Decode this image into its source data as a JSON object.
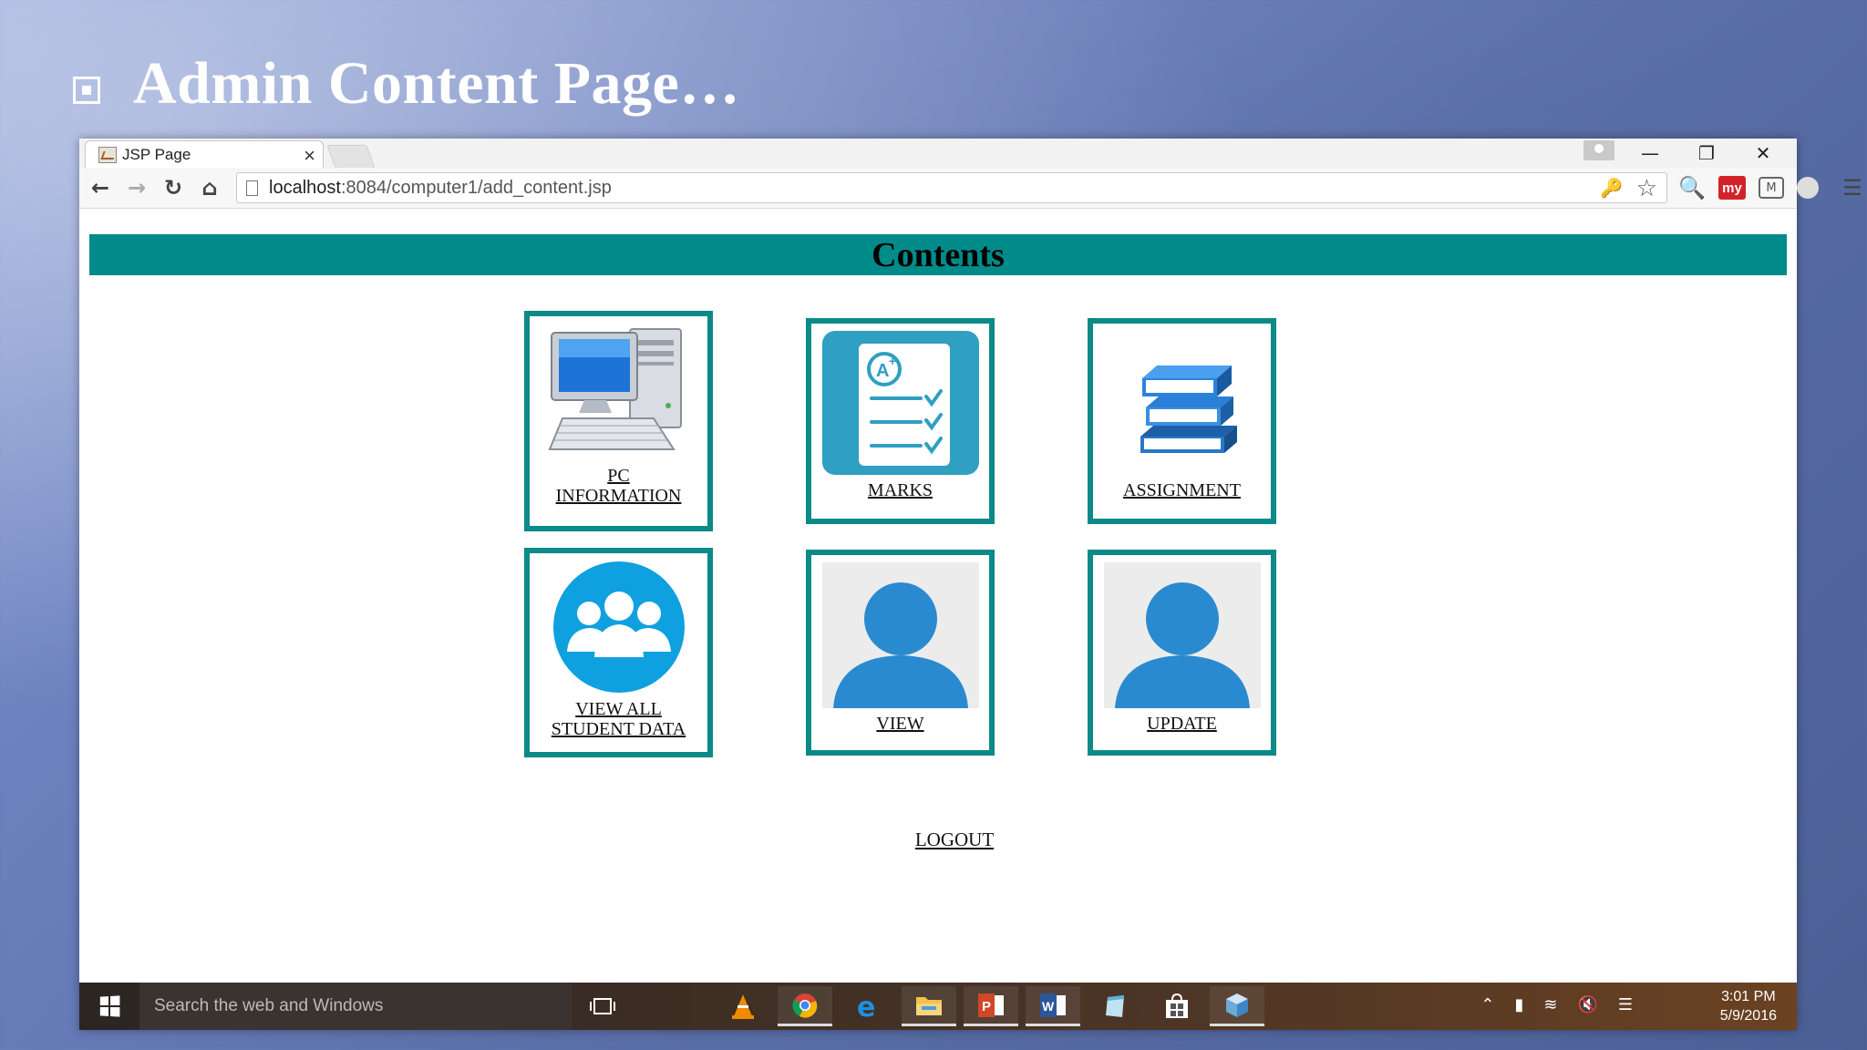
{
  "slide": {
    "title": "Admin Content Page…"
  },
  "browser": {
    "tab_title": "JSP Page",
    "tab_close": "×",
    "url_host": "localhost",
    "url_path": ":8084/computer1/add_content.jsp"
  },
  "page": {
    "header": "Contents",
    "tiles": [
      {
        "label_lines": [
          "PC",
          "INFORMATION"
        ],
        "icon": "computer-icon"
      },
      {
        "label_lines": [
          "MARKS"
        ],
        "icon": "marks-checklist-icon"
      },
      {
        "label_lines": [
          "ASSIGNMENT"
        ],
        "icon": "books-icon"
      },
      {
        "label_lines": [
          "VIEW ALL",
          "STUDENT DATA"
        ],
        "icon": "students-group-icon"
      },
      {
        "label_lines": [
          "VIEW"
        ],
        "icon": "user-icon"
      },
      {
        "label_lines": [
          "UPDATE"
        ],
        "icon": "user-icon"
      }
    ],
    "logout": "LOGOUT"
  },
  "taskbar": {
    "search_placeholder": "Search the web and Windows",
    "time": "3:01 PM",
    "date": "5/9/2016",
    "apps": [
      "task-view-icon",
      "vlc-icon",
      "chrome-icon",
      "edge-icon",
      "file-explorer-icon",
      "powerpoint-icon",
      "word-icon",
      "notepad-icon",
      "store-icon",
      "app-cube-icon"
    ]
  },
  "colors": {
    "teal": "#008b8b",
    "tile_border": "#0b8a88",
    "icon_blue": "#2a8ad0"
  }
}
